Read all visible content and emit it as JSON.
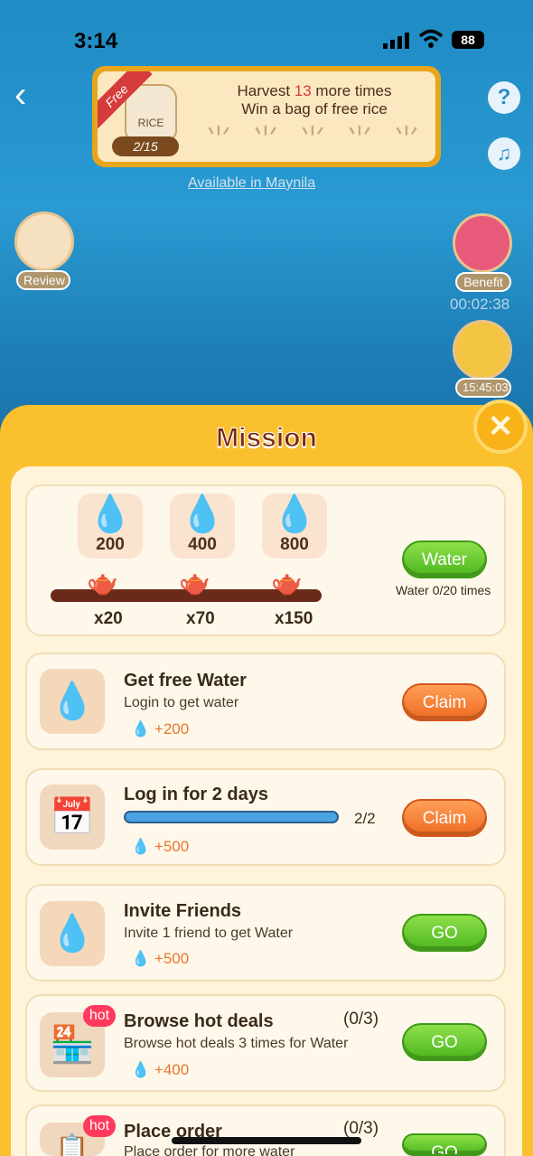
{
  "status": {
    "time": "3:14",
    "battery": "88"
  },
  "banner": {
    "ribbon": "Free",
    "bag_label": "RICE",
    "bag_count": "2/15",
    "line1_pre": "Harvest ",
    "line1_num": "13",
    "line1_post": " more times",
    "line2": "Win a bag of free rice",
    "availability": "Available in Maynila"
  },
  "side": {
    "review": "Review",
    "benefit": "Benefit",
    "benefit_timer": "00:02:38",
    "weather_timer": "15:45:03"
  },
  "mission": {
    "title": "Mission"
  },
  "water": {
    "milestones": [
      {
        "amount": "200",
        "times": "x20"
      },
      {
        "amount": "400",
        "times": "x70"
      },
      {
        "amount": "800",
        "times": "x150"
      }
    ],
    "button": "Water",
    "status": "Water 0/20 times"
  },
  "tasks": [
    {
      "title": "Get free Water",
      "subtitle": "Login to get water",
      "reward": "+200",
      "button": "Claim"
    },
    {
      "title": "Log in for 2 days",
      "progress_text": "2/2",
      "progress": 1.0,
      "reward": "+500",
      "button": "Claim"
    },
    {
      "title": "Invite Friends",
      "subtitle": "Invite 1 friend to get Water",
      "reward": "+500",
      "button": "GO"
    },
    {
      "title": "Browse hot deals",
      "count": "(0/3)",
      "subtitle": "Browse hot deals 3 times for Water",
      "reward": "+400",
      "button": "GO",
      "badge": "hot"
    },
    {
      "title": "Place order",
      "count": "(0/3)",
      "subtitle": "Place order for more water",
      "button": "GO",
      "badge": "hot"
    }
  ]
}
